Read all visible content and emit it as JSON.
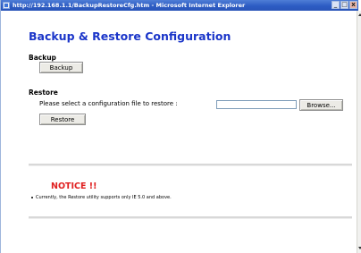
{
  "window": {
    "title": "http://192.168.1.1/BackupRestoreCfg.htm - Microsoft Internet Explorer",
    "minimize": "_",
    "maximize": "□",
    "close": "x"
  },
  "page": {
    "title": "Backup & Restore Configuration"
  },
  "backup": {
    "heading": "Backup",
    "button_label": "Backup"
  },
  "restore": {
    "heading": "Restore",
    "prompt": "Please select a configuration file to restore :",
    "file_value": "",
    "browse_label": "Browse...",
    "button_label": "Restore"
  },
  "notice": {
    "title": "NOTICE !!",
    "items": [
      "Currently, the Restore utility supports only IE 5.0 and above."
    ]
  },
  "colors": {
    "title_blue": "#1a35c9",
    "notice_red": "#e02020",
    "titlebar_blue": "#2d5cc4"
  }
}
